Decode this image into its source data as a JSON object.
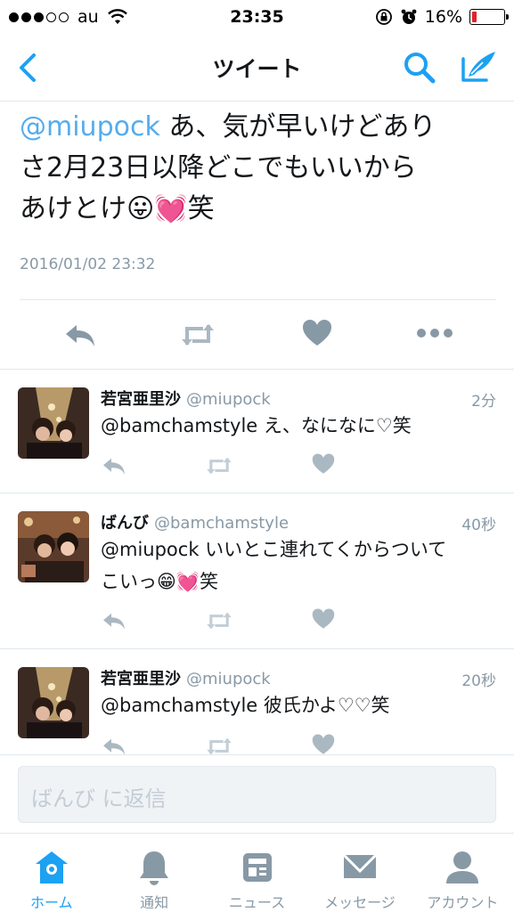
{
  "status_bar": {
    "carrier": "au",
    "time": "23:35",
    "battery": "16%",
    "battery_level": 0.16
  },
  "nav": {
    "title": "ツイート"
  },
  "tweet": {
    "mention": "@miupock",
    "text_line1": " あ、気が早いけどあり",
    "text_line2": "さ2月23日以降どこでもいいから",
    "text_line3": "あけとけ",
    "emoji": "😛💓",
    "text_tail": "笑",
    "timestamp": "2016/01/02 23:32"
  },
  "replies": [
    {
      "name": "若宮亜里沙",
      "handle": "@miupock",
      "time": "2分",
      "mention": "@bamchamstyle",
      "text": " え、なになに♡笑"
    },
    {
      "name": "ばんび",
      "handle": "@bamchamstyle",
      "time": "40秒",
      "mention": "@miupock",
      "text": " いいとこ連れてくからついて",
      "text2": "こいっ",
      "emoji": "😁💓",
      "text2_tail": "笑"
    },
    {
      "name": "若宮亜里沙",
      "handle": "@miupock",
      "time": "20秒",
      "mention": "@bamchamstyle",
      "text": " 彼氏かよ♡♡笑"
    }
  ],
  "reply_bar": {
    "placeholder": "ばんび に返信"
  },
  "tabs": [
    {
      "label": "ホーム",
      "icon": "home-icon"
    },
    {
      "label": "通知",
      "icon": "bell-icon"
    },
    {
      "label": "ニュース",
      "icon": "news-icon"
    },
    {
      "label": "メッセージ",
      "icon": "envelope-icon"
    },
    {
      "label": "アカウント",
      "icon": "person-icon"
    }
  ],
  "colors": {
    "accent": "#1da1f2",
    "mention": "#55acee",
    "muted": "#8899a6",
    "icon_gray": "#aab8c2",
    "battery_low": "#e0242b"
  }
}
